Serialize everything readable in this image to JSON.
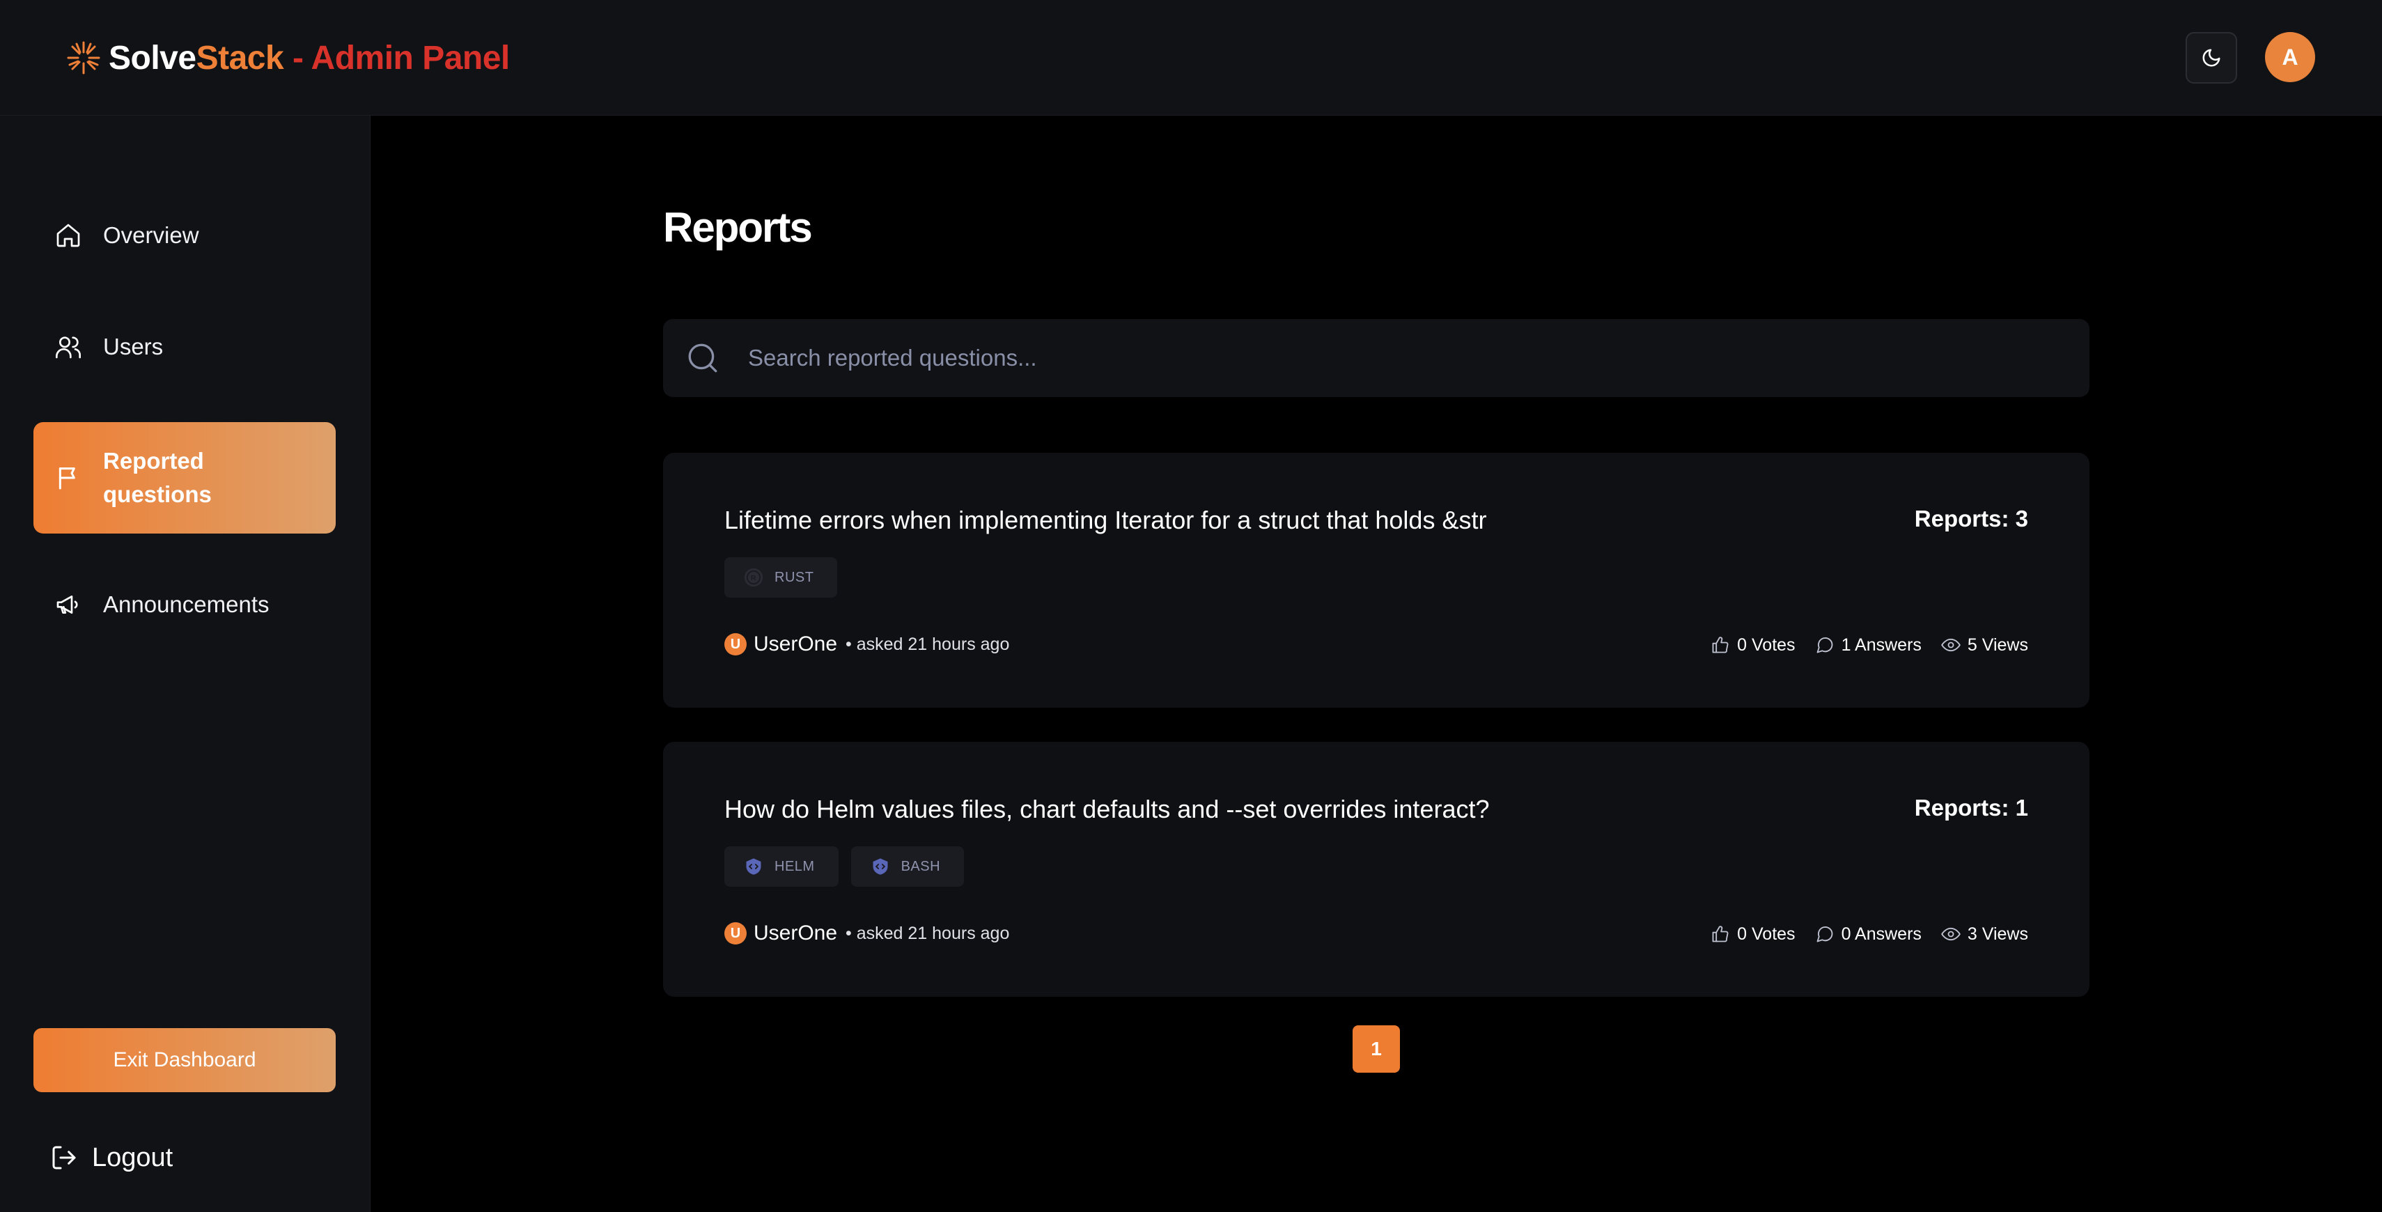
{
  "header": {
    "brand_solve": "Solve",
    "brand_stack": "Stack",
    "brand_admin": " - Admin Panel",
    "theme_icon": "moon-icon",
    "avatar_initial": "A"
  },
  "sidebar": {
    "items": [
      {
        "label": "Overview",
        "icon": "home-icon"
      },
      {
        "label": "Users",
        "icon": "users-icon"
      },
      {
        "label": "Reported questions",
        "icon": "flag-icon",
        "active": true
      },
      {
        "label": "Announcements",
        "icon": "megaphone-icon"
      }
    ],
    "exit_label": "Exit Dashboard",
    "logout_label": "Logout"
  },
  "main": {
    "title": "Reports",
    "search": {
      "placeholder": "Search reported questions..."
    },
    "questions": [
      {
        "title": "Lifetime errors when implementing Iterator for a struct that holds &str",
        "reports": "Reports: 3",
        "tags": [
          "RUST"
        ],
        "author_initial": "U",
        "author": "UserOne",
        "meta": "• asked 21 hours ago",
        "votes": "0 Votes",
        "answers": "1 Answers",
        "views": "5 Views"
      },
      {
        "title": "How do Helm values files, chart defaults and --set overrides interact?",
        "reports": "Reports: 1",
        "tags": [
          "HELM",
          "BASH"
        ],
        "author_initial": "U",
        "author": "UserOne",
        "meta": "• asked 21 hours ago",
        "votes": "0 Votes",
        "answers": "0 Answers",
        "views": "3 Views"
      }
    ],
    "pagination": {
      "current": "1"
    }
  },
  "colors": {
    "accent": "#ee7d32",
    "admin_red": "#d8322b",
    "surface": "#111216",
    "background": "#000000"
  }
}
